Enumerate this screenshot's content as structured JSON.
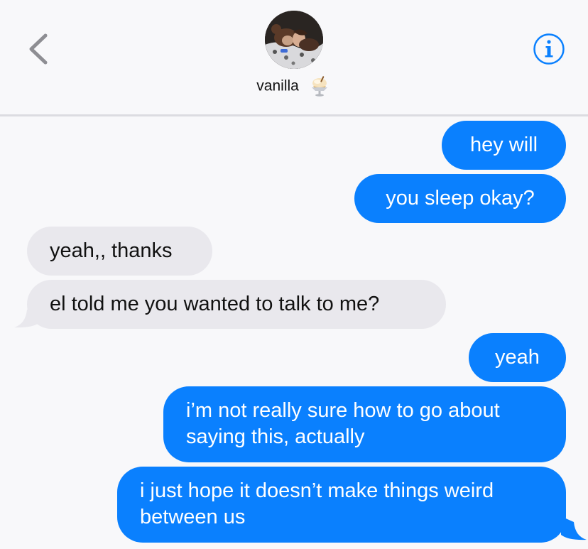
{
  "header": {
    "contact_name": "vanilla",
    "contact_emoji": "ice-cream-emoji",
    "back_icon": "chevron-left-icon",
    "info_icon": "info-icon",
    "accent_color": "#0a80fe"
  },
  "messages": [
    {
      "from": "me",
      "text": "hey will"
    },
    {
      "from": "me",
      "text": "you sleep okay?"
    },
    {
      "from": "them",
      "text": "yeah,, thanks"
    },
    {
      "from": "them",
      "text": "el told me you wanted to talk to me?"
    },
    {
      "from": "me",
      "text": "yeah"
    },
    {
      "from": "me",
      "lines": [
        "i’m not really sure how to go about",
        "saying this, actually"
      ]
    },
    {
      "from": "me",
      "lines": [
        "i just hope it doesn’t make things weird",
        "between us"
      ]
    }
  ],
  "colors": {
    "sent_bubble": "#0a80fe",
    "received_bubble": "#e9e8ed",
    "background": "#f8f8fa"
  }
}
